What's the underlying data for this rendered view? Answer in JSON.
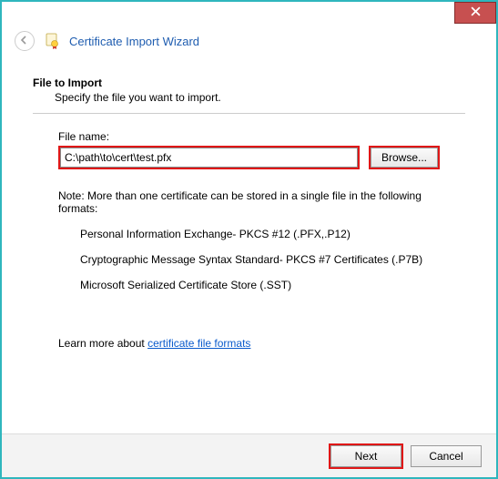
{
  "window": {
    "title": "Certificate Import Wizard"
  },
  "page": {
    "heading": "File to Import",
    "subheading": "Specify the file you want to import.",
    "file_label": "File name:",
    "file_value": "C:\\path\\to\\cert\\test.pfx",
    "browse_label": "Browse...",
    "note_intro": "Note:  More than one certificate can be stored in a single file in the following formats:",
    "formats": [
      "Personal Information Exchange- PKCS #12 (.PFX,.P12)",
      "Cryptographic Message Syntax Standard- PKCS #7 Certificates (.P7B)",
      "Microsoft Serialized Certificate Store (.SST)"
    ],
    "learn_prefix": "Learn more about ",
    "learn_link": "certificate file formats"
  },
  "footer": {
    "next": "Next",
    "cancel": "Cancel"
  },
  "icons": {
    "close": "close-icon",
    "back": "back-arrow-icon",
    "cert": "certificate-icon"
  }
}
